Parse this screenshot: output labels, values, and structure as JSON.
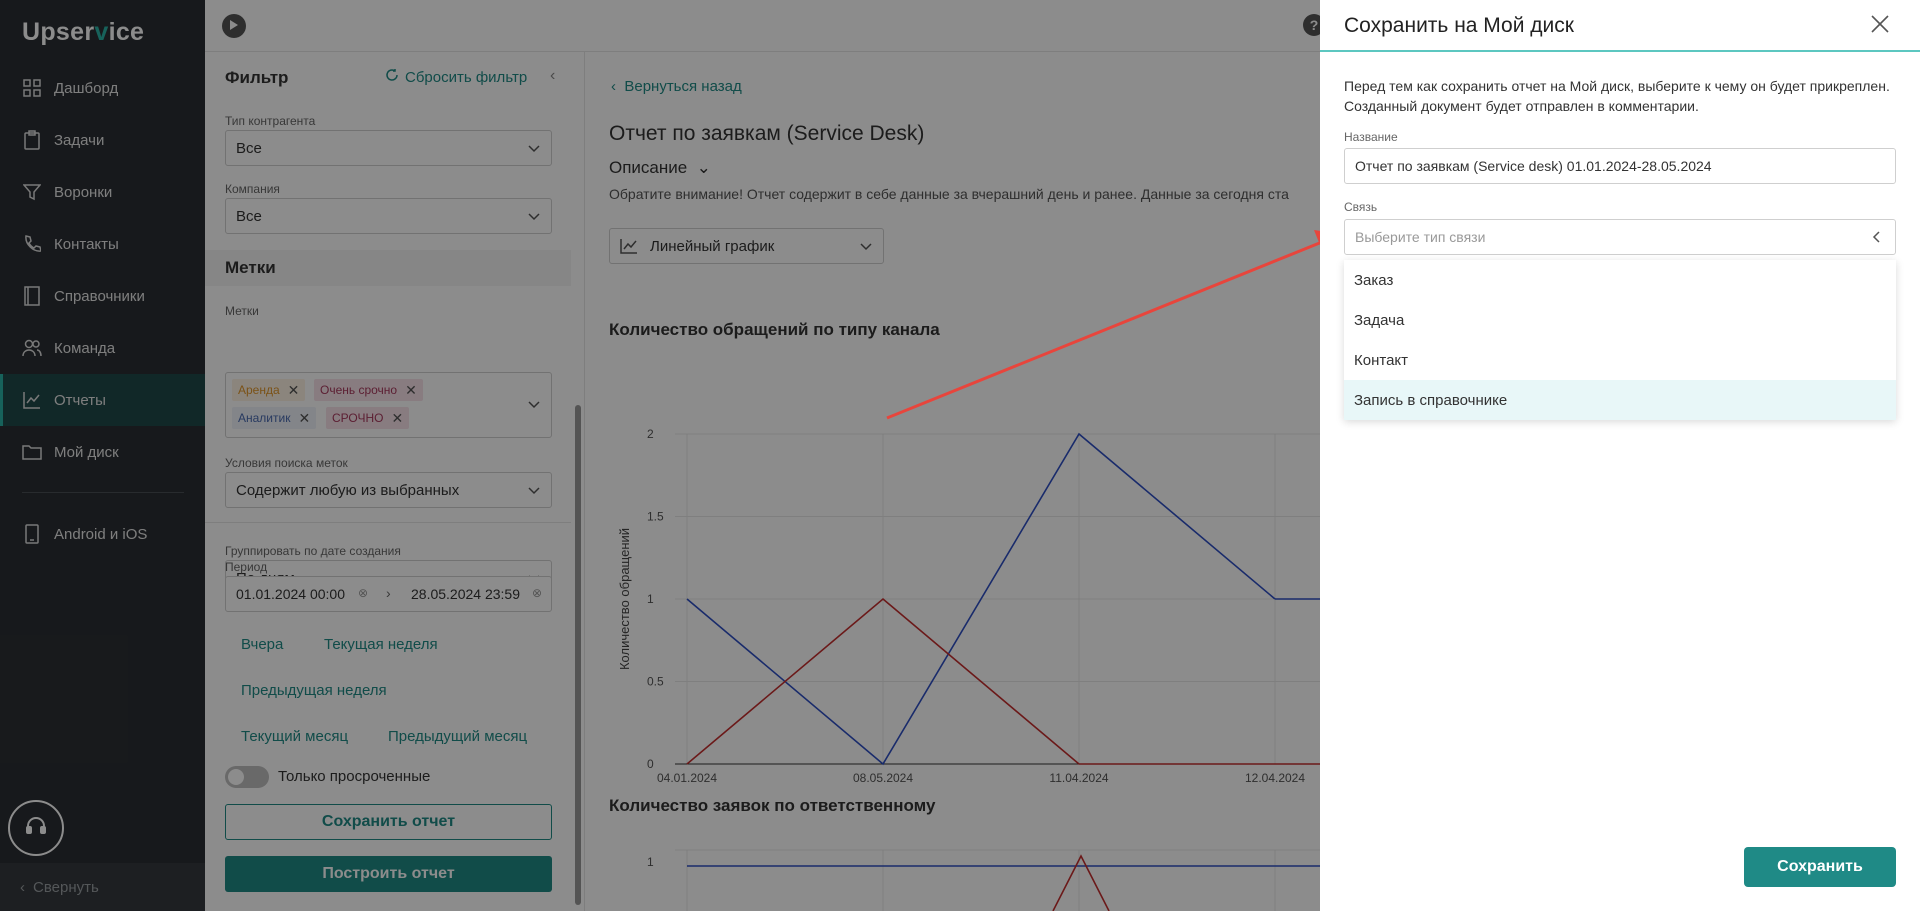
{
  "sidebar": {
    "logo_prefix": "Upser",
    "logo_v": "v",
    "logo_suffix": "ice",
    "items": [
      {
        "label": "Дашборд"
      },
      {
        "label": "Задачи"
      },
      {
        "label": "Воронки"
      },
      {
        "label": "Контакты"
      },
      {
        "label": "Справочники"
      },
      {
        "label": "Команда"
      },
      {
        "label": "Отчеты"
      },
      {
        "label": "Мой диск"
      },
      {
        "label": "Android и iOS"
      }
    ],
    "collapse_label": "Свернуть"
  },
  "topbar": {
    "help": "?"
  },
  "filter": {
    "title": "Фильтр",
    "reset_label": "Сбросить фильтр",
    "counterparty_label": "Тип контрагента",
    "counterparty_value": "Все",
    "company_label": "Компания",
    "company_value": "Все",
    "tags_section": "Метки",
    "tags_label": "Метки",
    "tags": [
      {
        "label": "Аренда"
      },
      {
        "label": "Очень срочно"
      },
      {
        "label": "Аналитик"
      },
      {
        "label": "СРОЧНО"
      }
    ],
    "search_cond_label": "Условия поиска меток",
    "search_cond_value": "Содержит любую из выбранных",
    "group_label": "Группировать по дате создания",
    "group_value": "По дням",
    "period_label": "Период",
    "period_from": "01.01.2024 00:00",
    "period_to": "28.05.2024 23:59",
    "quick": {
      "yesterday": "Вчера",
      "this_week": "Текущая неделя",
      "prev_week": "Предыдущая неделя",
      "this_month": "Текущий месяц",
      "prev_month": "Предыдущий месяц"
    },
    "overdue_label": "Только просроченные",
    "save_report": "Сохранить отчет",
    "build_report": "Построить отчет"
  },
  "content": {
    "back": "Вернуться назад",
    "title": "Отчет по заявкам (Service Desk)",
    "desc_head": "Описание",
    "desc_text": "Обратите внимание! Отчет содержит в себе данные за вчерашний день и ранее. Данные за сегодня ста",
    "chart_type": "Линейный график",
    "chart1_title": "Количество обращений по типу канала",
    "chart2_title": "Количество заявок по ответственному"
  },
  "chart_data": [
    {
      "type": "line",
      "title": "Количество обращений по типу канала",
      "ylabel": "Количество обращений",
      "x": [
        "04.01.2024",
        "08.05.2024",
        "11.04.2024",
        "12.04.2024"
      ],
      "yticks": [
        "0",
        "0.5",
        "1",
        "1.5",
        "2"
      ],
      "ylim": [
        0,
        2
      ],
      "series": [
        {
          "color": "#2f4fc4",
          "values": [
            1,
            0,
            2,
            1
          ]
        },
        {
          "color": "#c42f2f",
          "values": [
            0,
            1,
            0,
            0
          ]
        }
      ]
    },
    {
      "type": "line",
      "title": "Количество заявок по ответственному",
      "yticks": [
        "1"
      ]
    }
  ],
  "drawer": {
    "title": "Сохранить на Мой диск",
    "note": "Перед тем как сохранить отчет на Мой диск, выберите к чему он будет прикреплен. Созданный документ будет отправлен в комментарии.",
    "name_label": "Название",
    "name_value": "Отчет по заявкам (Service desk) 01.01.2024-28.05.2024",
    "link_label": "Связь",
    "link_placeholder": "Выберите тип связи",
    "options": [
      {
        "label": "Заказ"
      },
      {
        "label": "Задача"
      },
      {
        "label": "Контакт"
      },
      {
        "label": "Запись в справочнике"
      }
    ],
    "save_label": "Сохранить"
  },
  "colors": {
    "accent": "#1f8a86",
    "sidebar": "#2b2f33",
    "annotation_arrow": "#e8453c"
  }
}
